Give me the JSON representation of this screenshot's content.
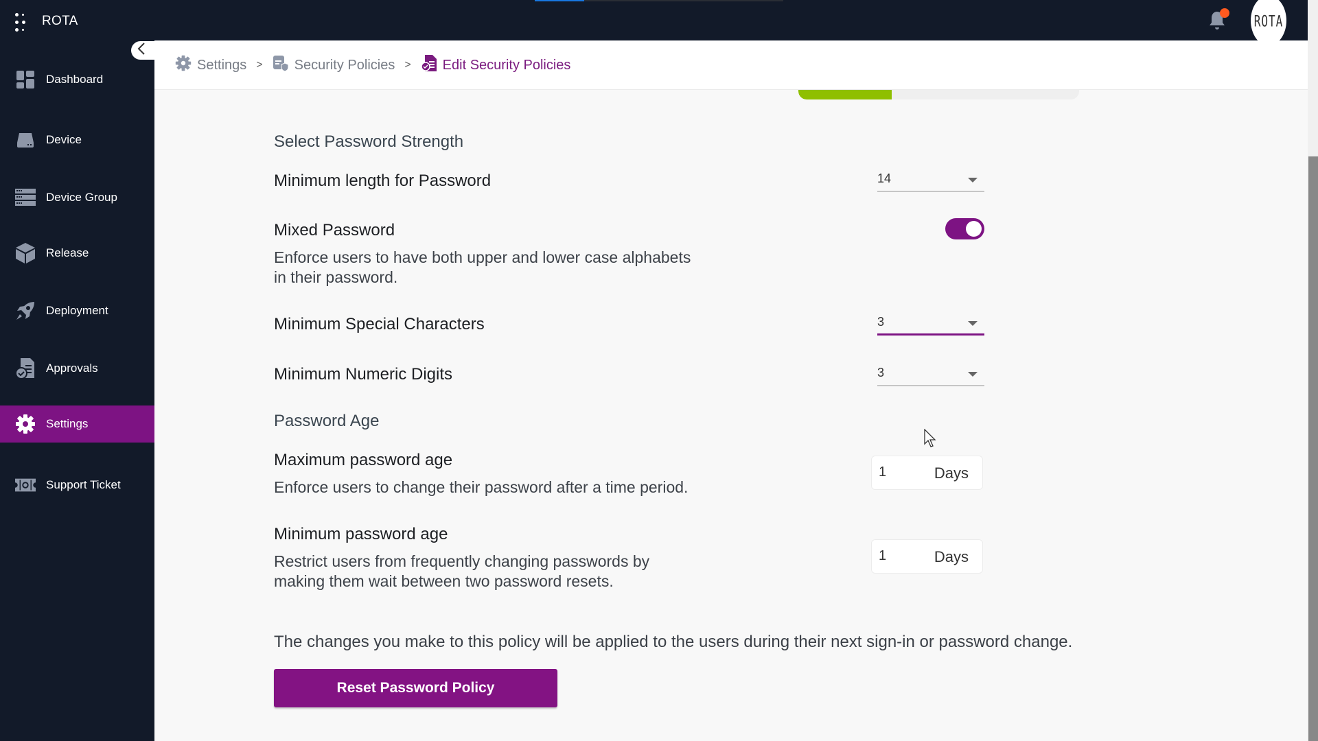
{
  "app": {
    "title": "ROTA",
    "avatar_text": "ROTA"
  },
  "loading_progress": 0.2,
  "sidebar": {
    "items": [
      {
        "label": "Dashboard",
        "icon": "dashboard-icon",
        "active": false
      },
      {
        "label": "Device",
        "icon": "device-icon",
        "active": false
      },
      {
        "label": "Device Group",
        "icon": "device-group-icon",
        "active": false
      },
      {
        "label": "Release",
        "icon": "box-icon",
        "active": false
      },
      {
        "label": "Deployment",
        "icon": "rocket-icon",
        "active": false
      },
      {
        "label": "Approvals",
        "icon": "approvals-icon",
        "active": false
      },
      {
        "label": "Settings",
        "icon": "gear-icon",
        "active": true
      },
      {
        "label": "Support Ticket",
        "icon": "ticket-icon",
        "active": false
      }
    ]
  },
  "breadcrumb": {
    "items": [
      {
        "label": "Settings",
        "icon": "gear-icon"
      },
      {
        "label": "Security Policies",
        "icon": "security-policy-icon"
      },
      {
        "label": "Edit Security Policies",
        "icon": "edit-policy-icon"
      }
    ],
    "separator": ">"
  },
  "strength_indicator": {
    "filled_segments": 1,
    "total_segments": 3,
    "fill_color": "#8fbf00"
  },
  "form": {
    "strength_section_title": "Select Password Strength",
    "min_length": {
      "label": "Minimum length for Password",
      "value": "14"
    },
    "mixed_password": {
      "label": "Mixed Password",
      "enabled": true,
      "description_line1": "Enforce users to have both upper and lower case alphabets",
      "description_line2": "in their password."
    },
    "min_special": {
      "label": "Minimum Special Characters",
      "value": "3"
    },
    "min_numeric": {
      "label": "Minimum Numeric Digits",
      "value": "3"
    },
    "age_section_title": "Password Age",
    "max_age": {
      "label": "Maximum password age",
      "description": "Enforce users to change their password after a time period.",
      "value": "1",
      "unit": "Days"
    },
    "min_age": {
      "label": "Minimum password age",
      "description_line1": "Restrict users from frequently changing passwords by",
      "description_line2": "making them wait between two password resets.",
      "value": "1",
      "unit": "Days"
    },
    "note": "The changes you make to this policy will be applied to the users during their next sign-in or password change.",
    "reset_button": "Reset Password Policy"
  },
  "colors": {
    "brand": "#7d1383",
    "navbar": "#121a29",
    "strength": "#8fbf00",
    "badge": "#ff5a1f"
  }
}
